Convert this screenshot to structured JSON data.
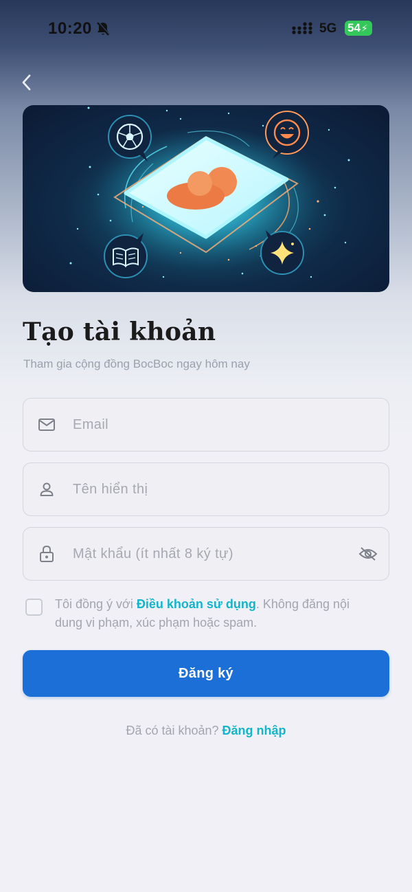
{
  "status_bar": {
    "time": "10:20",
    "network": "5G",
    "battery": "54"
  },
  "header": {
    "back_icon": "chevron-left-icon"
  },
  "hero": {
    "icons": [
      "soccer-ball-icon",
      "laughing-face-icon",
      "book-icon",
      "sparkle-icon",
      "user-card-icon"
    ]
  },
  "page": {
    "title": "Tạo tài khoản",
    "subtitle": "Tham gia cộng đồng BocBoc ngay hôm nay"
  },
  "form": {
    "email_placeholder": "Email",
    "display_name_placeholder": "Tên hiển thị",
    "password_placeholder": "Mật khẩu (ít nhất 8 ký tự)",
    "terms_prefix": "Tôi đồng ý với ",
    "terms_link": "Điều khoản sử dụng",
    "terms_suffix": ". Không đăng nội dung vi phạm, xúc phạm hoặc spam.",
    "submit_label": "Đăng ký"
  },
  "footer": {
    "login_prompt": "Đã có tài khoản? ",
    "login_link": "Đăng nhập"
  },
  "colors": {
    "primary": "#1c6fd6",
    "link": "#13b5c9",
    "battery": "#34c759",
    "background": "#f0f0f6"
  }
}
